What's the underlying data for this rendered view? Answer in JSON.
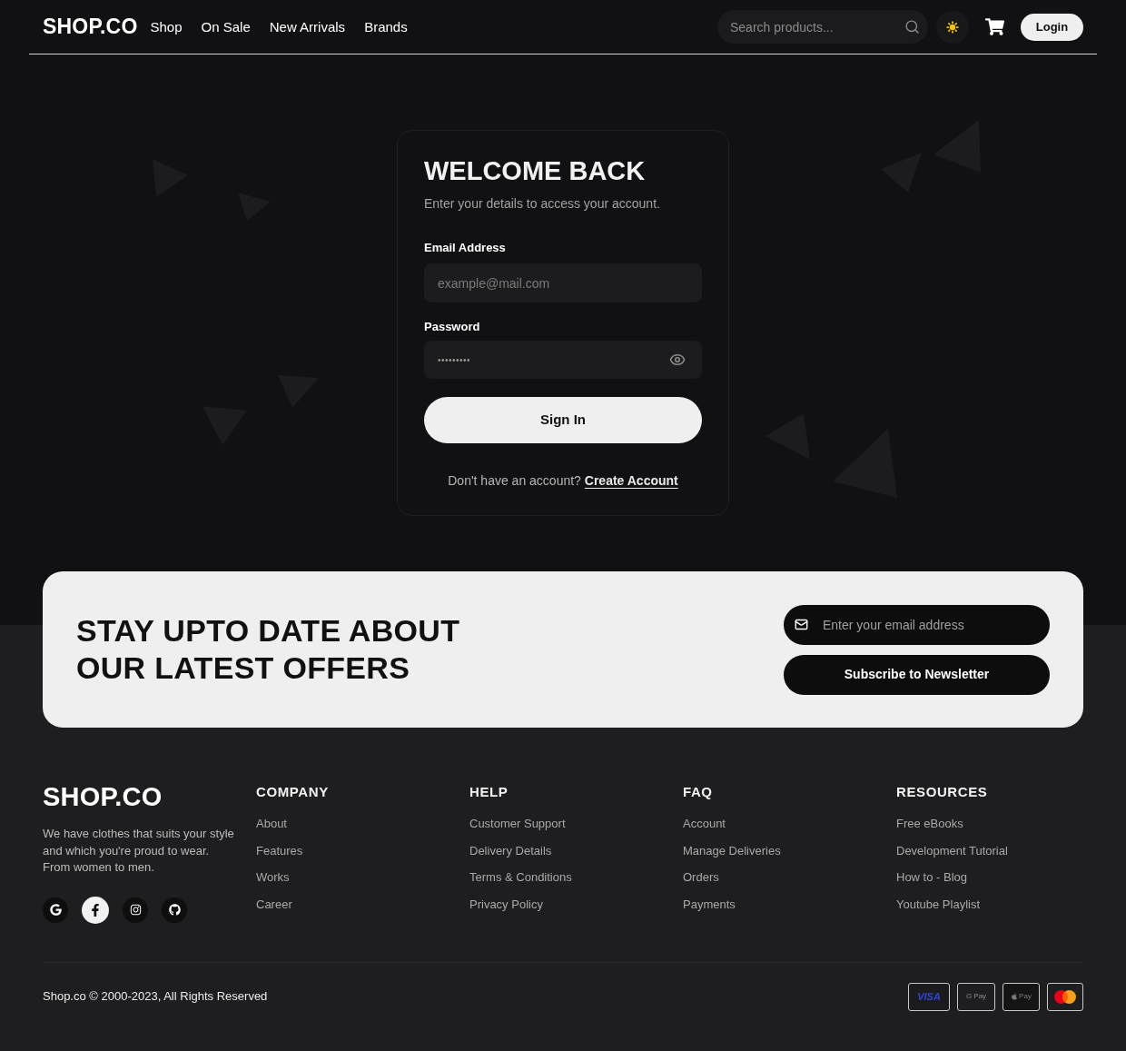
{
  "header": {
    "logo": "SHOP.CO",
    "nav": [
      "Shop",
      "On Sale",
      "New Arrivals",
      "Brands"
    ],
    "search": {
      "placeholder": "Search products..."
    },
    "login_button": "Login"
  },
  "login": {
    "title": "WELCOME BACK",
    "subtitle": "Enter your details to access your account.",
    "email": {
      "label": "Email Address",
      "placeholder": "example@mail.com"
    },
    "password": {
      "label": "Password",
      "value": "•••••••••"
    },
    "submit": "Sign In",
    "signup_prompt": "Don't have an account?",
    "signup_link": "Create Account"
  },
  "newsletter": {
    "heading_lines": [
      "STAY UPTO DATE ABOUT",
      "OUR LATEST OFFERS"
    ],
    "email": {
      "placeholder": "Enter your email address"
    },
    "button": "Subscribe to Newsletter"
  },
  "footer": {
    "logo": "SHOP.CO",
    "description_lines": [
      "We have clothes that suits your style",
      "and which you're proud to wear.",
      "From women to men."
    ],
    "social": [
      {
        "kind": "google",
        "highlighted": false
      },
      {
        "kind": "facebook",
        "highlighted": true
      },
      {
        "kind": "instagram",
        "highlighted": false
      },
      {
        "kind": "github",
        "highlighted": false
      }
    ],
    "columns": [
      {
        "title": "COMPANY",
        "links": [
          "About",
          "Features",
          "Works",
          "Career"
        ]
      },
      {
        "title": "HELP",
        "links": [
          "Customer Support",
          "Delivery Details",
          "Terms & Conditions",
          "Privacy Policy"
        ]
      },
      {
        "title": "FAQ",
        "links": [
          "Account",
          "Manage Deliveries",
          "Orders",
          "Payments"
        ]
      },
      {
        "title": "RESOURCES",
        "links": [
          "Free eBooks",
          "Development Tutorial",
          "How to - Blog",
          "Youtube Playlist"
        ]
      }
    ],
    "copyright": "Shop.co © 2000-2023, All Rights Reserved",
    "payments": [
      {
        "kind": "visa",
        "label": "VISA"
      },
      {
        "kind": "gpay",
        "label": "G Pay"
      },
      {
        "kind": "applepay",
        "label": "Pay"
      },
      {
        "kind": "mastercard"
      }
    ]
  }
}
